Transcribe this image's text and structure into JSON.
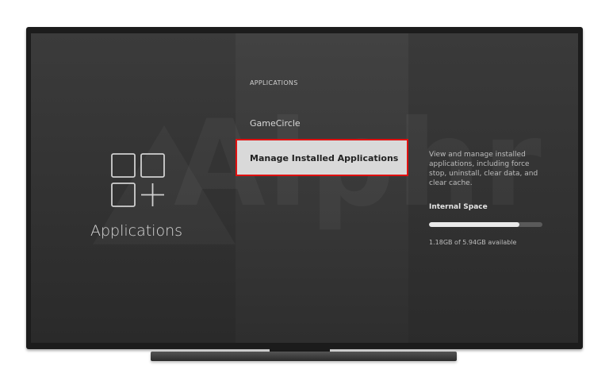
{
  "left_panel": {
    "title": "Applications",
    "icon": "applications-grid-plus-icon"
  },
  "menu": {
    "header": "APPLICATIONS",
    "items": [
      {
        "label": "GameCircle"
      },
      {
        "label": "Manage Installed Applications",
        "selected": true
      }
    ]
  },
  "details": {
    "description": "View and manage installed applications, including force stop, uninstall, clear data, and clear cache.",
    "storage_title": "Internal Space",
    "storage_text": "1.18GB of 5.94GB available",
    "storage_used_fraction": 0.8
  },
  "watermark": "Alphr",
  "colors": {
    "selection_border": "#e01010",
    "selection_bg": "#d9d9d9"
  }
}
